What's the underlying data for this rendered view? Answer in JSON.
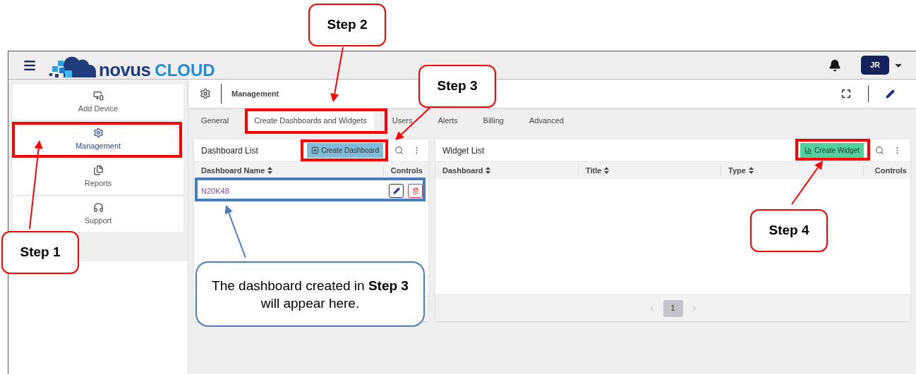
{
  "header": {
    "brand": "novus",
    "brand_suffix": "CLOUD",
    "avatar": "JR"
  },
  "sidebar": {
    "items": [
      {
        "label": "Add Device",
        "selected": false
      },
      {
        "label": "Management",
        "selected": true
      },
      {
        "label": "Reports",
        "selected": false
      },
      {
        "label": "Support",
        "selected": false
      }
    ]
  },
  "breadcrumb": {
    "title": "Management"
  },
  "tabs": [
    {
      "label": "General",
      "selected": false
    },
    {
      "label": "Create Dashboards and Widgets",
      "selected": true
    },
    {
      "label": "Users",
      "selected": false
    },
    {
      "label": "Alerts",
      "selected": false
    },
    {
      "label": "Billing",
      "selected": false
    },
    {
      "label": "Advanced",
      "selected": false
    }
  ],
  "dashboard_list": {
    "title": "Dashboard List",
    "button": "Create Dashboard",
    "columns": [
      "Dashboard Name",
      "Controls"
    ],
    "rows": [
      {
        "name": "N20K48"
      }
    ]
  },
  "widget_list": {
    "title": "Widget List",
    "button": "Create Widget",
    "columns": [
      "Dashboard",
      "Title",
      "Type",
      "Controls"
    ],
    "pagination": {
      "page": "1"
    }
  },
  "annotations": {
    "steps": [
      "Step 1",
      "Step 2",
      "Step 3",
      "Step 4"
    ],
    "note": "The dashboard created in **Step 3** will appear here."
  }
}
